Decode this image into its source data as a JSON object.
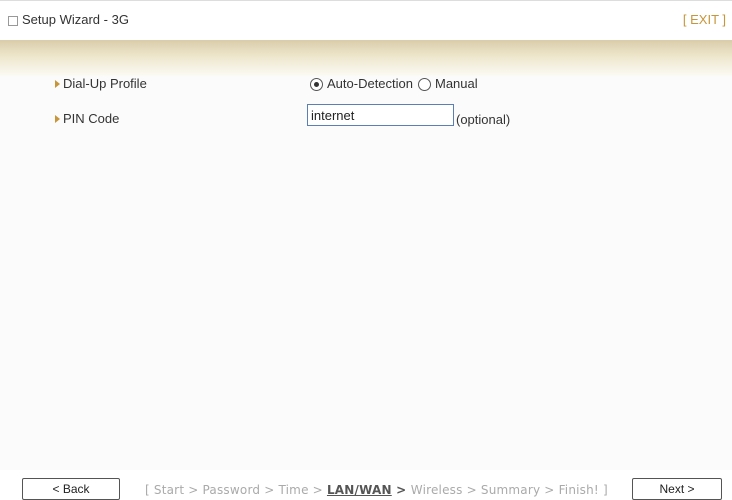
{
  "window": {
    "title": "Setup Wizard - 3G",
    "exit_label": "[ EXIT ]"
  },
  "form": {
    "dialup": {
      "label": "Dial-Up Profile",
      "options": [
        {
          "label": "Auto-Detection",
          "selected": true
        },
        {
          "label": "Manual",
          "selected": false
        }
      ]
    },
    "pin": {
      "label": "PIN Code",
      "value": "internet",
      "hint": "(optional)"
    }
  },
  "footer": {
    "back_label": "< Back",
    "next_label": "Next >",
    "steps": {
      "open": "[ ",
      "items": [
        "Start",
        "Password",
        "Time",
        "LAN/WAN",
        "Wireless",
        "Summary",
        "Finish!"
      ],
      "separator": " > ",
      "current_index": 3,
      "close": " ]"
    }
  },
  "colors": {
    "accent": "#c8963a",
    "band_top": "#d9ccaa",
    "input_border": "#5b7fb5"
  }
}
